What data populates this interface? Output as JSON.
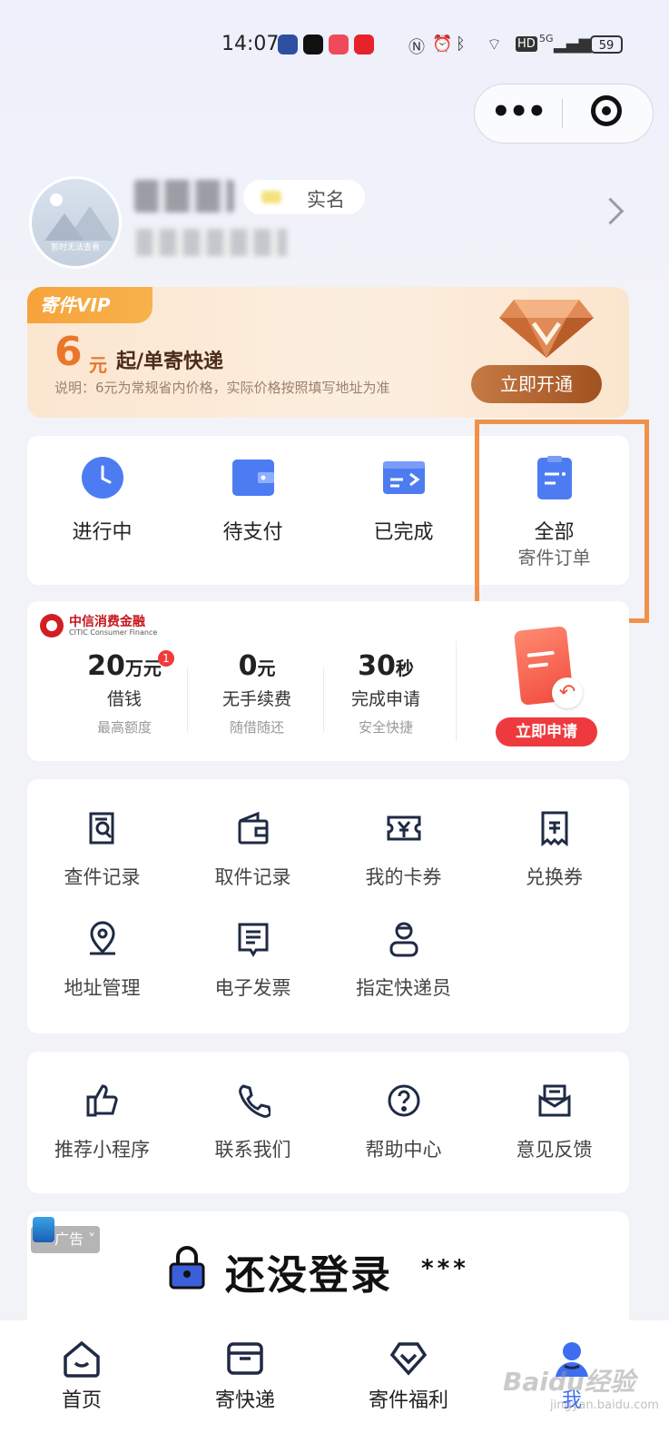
{
  "status_bar": {
    "time": "14:07",
    "battery": "59",
    "network": "5G",
    "hd": "HD"
  },
  "profile": {
    "avatar_caption": "暂时无法查看",
    "realname_label": "实名"
  },
  "vip": {
    "tag": "寄件VIP",
    "price": "6",
    "unit": "元",
    "desc": "起/单寄快递",
    "note": "说明：6元为常规省内价格，实际价格按照填写地址为准",
    "button": "立即开通"
  },
  "orders": [
    {
      "label": "进行中",
      "icon": "clock-icon"
    },
    {
      "label": "待支付",
      "icon": "wallet-icon"
    },
    {
      "label": "已完成",
      "icon": "box-arrow-icon"
    },
    {
      "label": "全部",
      "sub": "寄件订单",
      "icon": "clipboard-icon"
    }
  ],
  "loan": {
    "brand": "中信消费金融",
    "brand_en": "CITIC Consumer Finance",
    "badge": "1",
    "columns": [
      {
        "value": "20",
        "unit": "万元",
        "label": "借钱",
        "sub": "最高额度"
      },
      {
        "value": "0",
        "unit": "元",
        "label": "无手续费",
        "sub": "随借随还"
      },
      {
        "value": "30",
        "unit": "秒",
        "label": "完成申请",
        "sub": "安全快捷"
      }
    ],
    "button": "立即申请"
  },
  "tools": [
    {
      "label": "查件记录",
      "icon": "search-record-icon"
    },
    {
      "label": "取件记录",
      "icon": "pickup-record-icon"
    },
    {
      "label": "我的卡券",
      "icon": "coupon-icon"
    },
    {
      "label": "兑换券",
      "icon": "voucher-icon"
    },
    {
      "label": "地址管理",
      "icon": "location-icon"
    },
    {
      "label": "电子发票",
      "icon": "invoice-icon"
    },
    {
      "label": "指定快递员",
      "icon": "courier-icon"
    }
  ],
  "more": [
    {
      "label": "推荐小程序",
      "icon": "thumbs-up-icon"
    },
    {
      "label": "联系我们",
      "icon": "phone-icon"
    },
    {
      "label": "帮助中心",
      "icon": "help-icon"
    },
    {
      "label": "意见反馈",
      "icon": "feedback-icon"
    }
  ],
  "ad": {
    "tag": "广告",
    "text": "还没登录",
    "stars": "***"
  },
  "tabbar": [
    {
      "label": "首页",
      "icon": "home-icon"
    },
    {
      "label": "寄快递",
      "icon": "parcel-icon"
    },
    {
      "label": "寄件福利",
      "icon": "benefit-icon"
    },
    {
      "label": "我",
      "icon": "me-icon",
      "active": true
    }
  ],
  "watermark": {
    "text": "Baidu经验",
    "sub": "jingyan.baidu.com"
  },
  "colors": {
    "accent": "#3d6ef0",
    "orange_highlight": "#f0914a",
    "vip_orange": "#e9762a",
    "loan_red": "#ee3a3e",
    "icon_navy": "#1f2a44"
  }
}
